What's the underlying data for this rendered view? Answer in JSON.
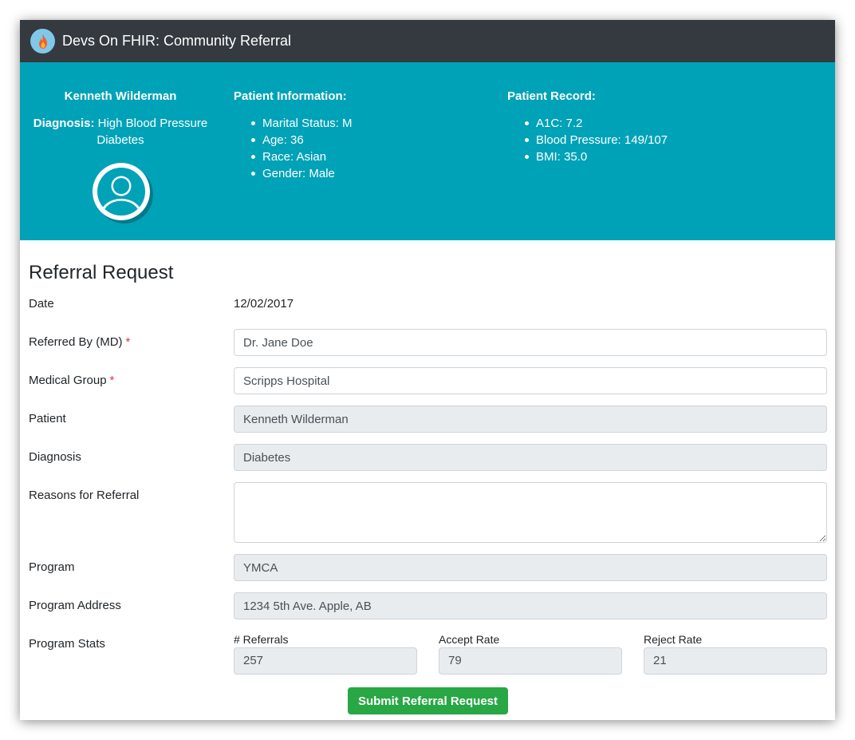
{
  "app": {
    "title": "Devs On FHIR: Community Referral"
  },
  "patient": {
    "name": "Kenneth Wilderman",
    "diagnosis_label": "Diagnosis:",
    "diagnosis_line1": "High Blood Pressure",
    "diagnosis_line2": "Diabetes",
    "info_heading": "Patient Information:",
    "info": [
      "Marital Status: M",
      "Age: 36",
      "Race: Asian",
      "Gender: Male"
    ],
    "record_heading": "Patient Record:",
    "record": [
      "A1C: 7.2",
      "Blood Pressure: 149/107",
      "BMI: 35.0"
    ]
  },
  "form": {
    "title": "Referral Request",
    "date_label": "Date",
    "date_value": "12/02/2017",
    "referred_by_label": "Referred By (MD)",
    "referred_by_value": "Dr. Jane Doe",
    "medical_group_label": "Medical Group",
    "medical_group_value": "Scripps Hospital",
    "required_mark": "*",
    "patient_label": "Patient",
    "patient_value": "Kenneth Wilderman",
    "diagnosis_label": "Diagnosis",
    "diagnosis_value": "Diabetes",
    "reasons_label": "Reasons for Referral",
    "reasons_value": "",
    "program_label": "Program",
    "program_value": "YMCA",
    "program_address_label": "Program Address",
    "program_address_value": "1234 5th Ave. Apple, AB",
    "program_stats_label": "Program Stats",
    "stats": {
      "referrals_label": "# Referrals",
      "referrals_value": "257",
      "accept_label": "Accept Rate",
      "accept_value": "79",
      "reject_label": "Reject Rate",
      "reject_value": "21"
    },
    "submit_label": "Submit Referral Request"
  },
  "colors": {
    "navbar": "#343a40",
    "banner": "#00a2b8",
    "submit": "#28a745",
    "required": "#dc3545",
    "readonly_field": "#e9ecef"
  },
  "icons": {
    "brand": "flame-icon",
    "avatar": "user-avatar-icon"
  }
}
